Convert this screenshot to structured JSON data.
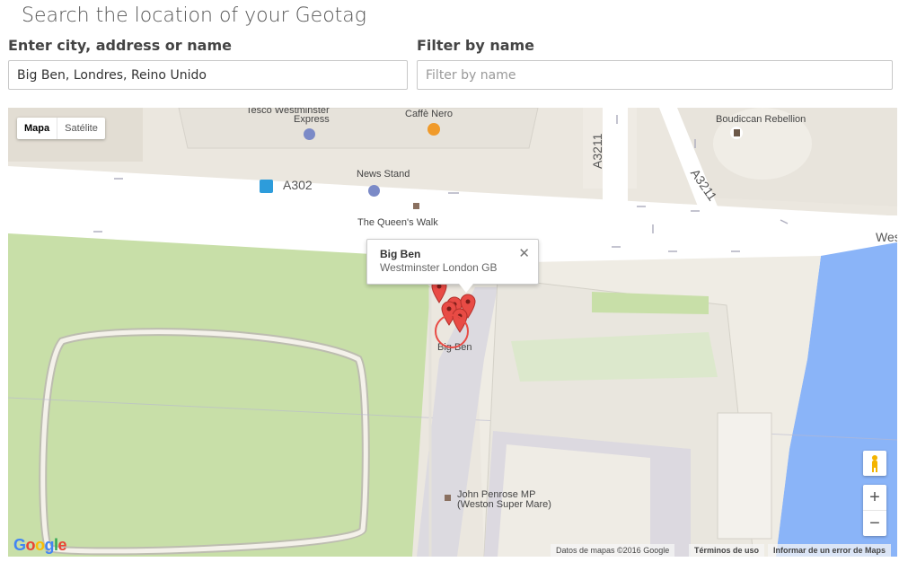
{
  "header": {
    "title": "Search the location of your Geotag"
  },
  "search": {
    "label": "Enter city, address or name",
    "value": "Big Ben, Londres, Reino Unido"
  },
  "filter": {
    "label": "Filter by name",
    "placeholder": "Filter by name"
  },
  "map": {
    "type_buttons": {
      "map": "Mapa",
      "satellite": "Satélite",
      "selected": "Mapa"
    },
    "places": {
      "tesco_line1": "Tesco Westminster",
      "tesco_line2": "Express",
      "caffe_nero": "Caffè Nero",
      "boudiccan": "Boudiccan Rebellion",
      "news_stand": "News Stand",
      "queens_walk": "The Queen's Walk",
      "big_ben": "Big Ben",
      "penrose_line1": "John Penrose MP",
      "penrose_line2": "(Weston Super Mare)"
    },
    "roads": {
      "a302": "A302",
      "a3211_a": "A3211",
      "a3211_b": "A3211",
      "west": "Wes"
    },
    "info_window": {
      "title": "Big Ben",
      "address": "Westminster London GB"
    },
    "markers_count": 5,
    "footer": {
      "attribution": "Datos de mapas ©2016 Google",
      "terms": "Términos de uso",
      "report": "Informar de un error de Maps"
    },
    "logo": "Google",
    "colors": {
      "water": "#8ab4f8",
      "park": "#c8dfa8",
      "marker": "#e84b45"
    }
  }
}
